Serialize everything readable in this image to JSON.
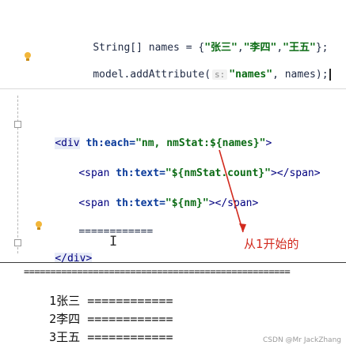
{
  "code_top": {
    "line1": {
      "type_decl": "String[] names = {",
      "s1": "\"张三\"",
      "sep1": ",",
      "s2": "\"李四\"",
      "sep2": ",",
      "s3": "\"王五\"",
      "close": "};"
    },
    "line2": {
      "prefix": "model.addAttribute(",
      "hint": "s:",
      "arg1": "\"names\"",
      "rest": ", names);"
    }
  },
  "code_bottom": {
    "div_open": {
      "tag": "<div",
      "attr": "th:each=",
      "value": "\"nm, nmStat:${names}\"",
      "end": ">"
    },
    "span1": {
      "open": "<span",
      "attr": "th:text=",
      "value": "\"${nmStat.count}\"",
      "close": "></span>"
    },
    "span2": {
      "open": "<span",
      "attr": "th:text=",
      "value": "\"${nm}\"",
      "close": "></span>"
    },
    "separator": "============",
    "div_close": "</div>"
  },
  "annotation": "从1开始的",
  "output": {
    "rule": "==================================================",
    "rows": [
      {
        "index": "1",
        "name": "张三",
        "bar": "============"
      },
      {
        "index": "2",
        "name": "李四",
        "bar": "============"
      },
      {
        "index": "3",
        "name": "王五",
        "bar": "============"
      }
    ]
  },
  "watermark": "CSDN @Mr JackZhang",
  "colors": {
    "annotation_red": "#d22a1e",
    "string_green": "#0b6b14",
    "tag_navy": "#00007f"
  }
}
